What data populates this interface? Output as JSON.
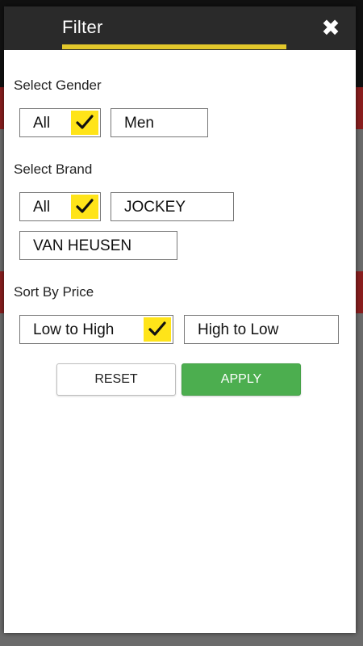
{
  "dialog": {
    "title": "Filter",
    "close_icon": "close-icon"
  },
  "gender": {
    "label": "Select Gender",
    "options": [
      {
        "label": "All",
        "selected": true
      },
      {
        "label": "Men",
        "selected": false
      }
    ]
  },
  "brand": {
    "label": "Select Brand",
    "options": [
      {
        "label": "All",
        "selected": true
      },
      {
        "label": "JOCKEY",
        "selected": false
      },
      {
        "label": "VAN HEUSEN",
        "selected": false
      }
    ]
  },
  "sort": {
    "label": "Sort By Price",
    "options": [
      {
        "label": "Low to High",
        "selected": true
      },
      {
        "label": "High to Low",
        "selected": false
      }
    ]
  },
  "actions": {
    "reset_label": "RESET",
    "apply_label": "APPLY"
  },
  "colors": {
    "accent_yellow": "#ffe419",
    "header_underline": "#e3c82b",
    "apply_green": "#4cae4f",
    "header_bg": "#2a2a2a"
  }
}
